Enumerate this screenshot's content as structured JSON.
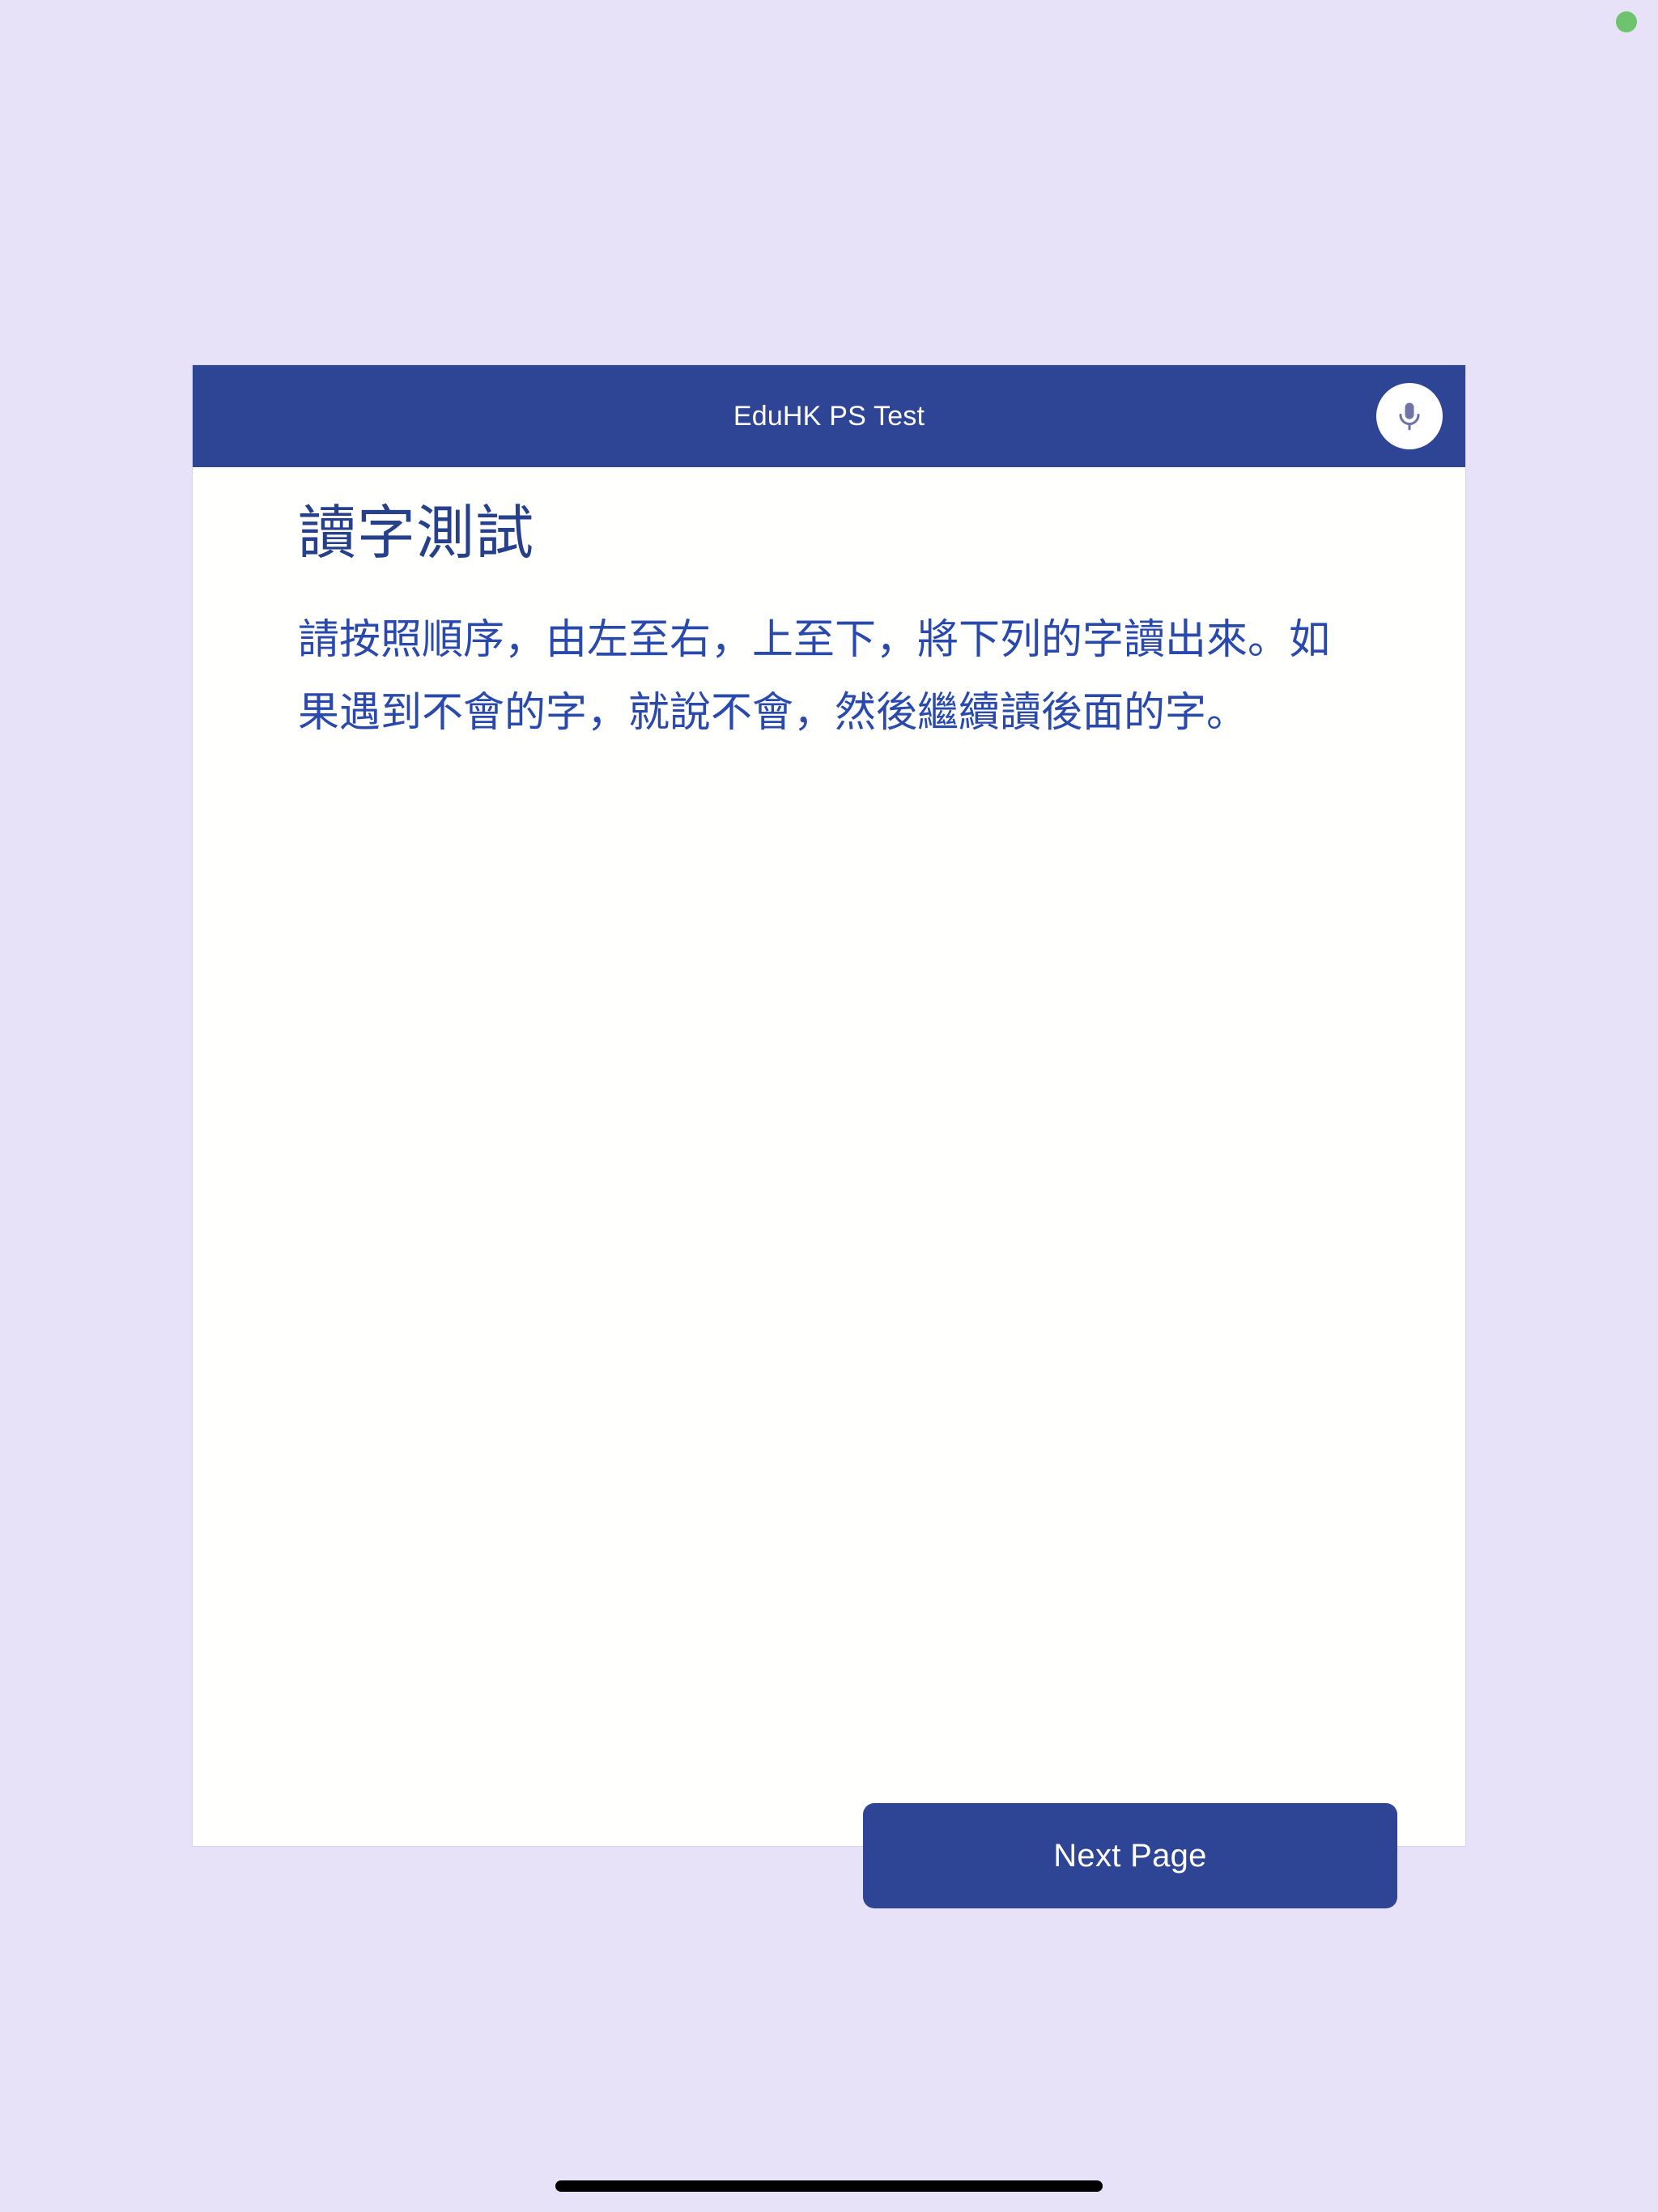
{
  "colors": {
    "page_background": "#E7E2F7",
    "brand_blue": "#2E4494",
    "title_blue": "#26408B",
    "body_blue": "#2A49AC",
    "card_white": "#FFFFFE",
    "status_green": "#6EC46E",
    "mic_glyph": "#6F75A8",
    "home_indicator": "#000000"
  },
  "status_bar": {
    "indicator_name": "recording-indicator-dot",
    "indicator_color": "#6EC46E"
  },
  "header": {
    "title": "EduHK PS Test",
    "mic_button_icon": "microphone-icon"
  },
  "main": {
    "page_title": "讀字測試",
    "instruction": "請按照順序，由左至右，上至下，將下列的字讀出來。如果遇到不會的字，就說不會，然後繼續讀後面的字。"
  },
  "footer": {
    "next_label": "Next Page"
  },
  "system": {
    "home_indicator_name": "home-indicator-bar"
  }
}
